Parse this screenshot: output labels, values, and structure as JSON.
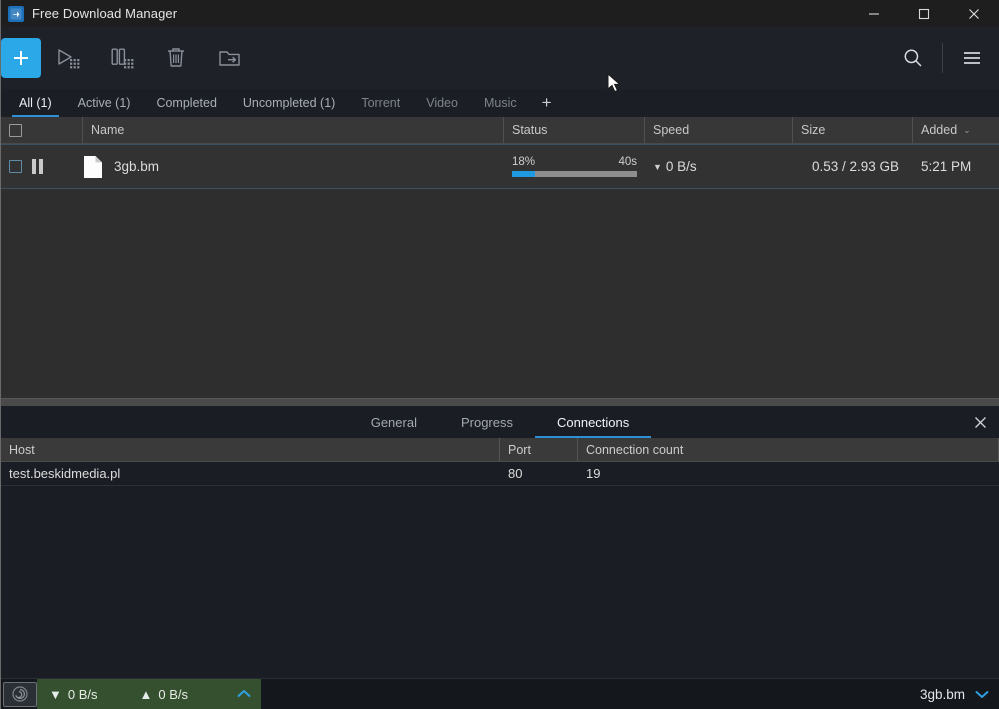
{
  "window": {
    "title": "Free Download Manager",
    "app_icon": "download-arrow-icon",
    "minimize_label": "–",
    "maximize_label": "□",
    "close_label": "✕"
  },
  "toolbar": {
    "add_label": "+",
    "buttons": [
      {
        "name": "resume-all-button",
        "icon": "play-all-icon"
      },
      {
        "name": "pause-all-button",
        "icon": "pause-all-icon"
      },
      {
        "name": "delete-button",
        "icon": "trash-icon"
      },
      {
        "name": "move-to-folder-button",
        "icon": "folder-move-icon"
      }
    ],
    "search_icon": "search-icon",
    "menu_icon": "hamburger-menu-icon"
  },
  "filters": {
    "tabs": [
      {
        "label": "All (1)",
        "active": true
      },
      {
        "label": "Active (1)",
        "active": false
      },
      {
        "label": "Completed",
        "active": false
      },
      {
        "label": "Uncompleted (1)",
        "active": false
      },
      {
        "label": "Torrent",
        "active": false
      },
      {
        "label": "Video",
        "active": false
      },
      {
        "label": "Music",
        "active": false
      }
    ],
    "add_tab_label": "+"
  },
  "downloads": {
    "columns": {
      "name": "Name",
      "status": "Status",
      "speed": "Speed",
      "size": "Size",
      "added": "Added",
      "sort_caret": "⌄"
    },
    "rows": [
      {
        "filename": "3gb.bm",
        "state_icon": "pause-icon",
        "file_icon": "file-icon",
        "progress_percent": "18%",
        "progress_value": 18,
        "eta": "40s",
        "speed": "0 B/s",
        "speed_arrow": "▼",
        "size": "0.53 / 2.93 GB",
        "added": "5:21 PM",
        "selected": true
      }
    ]
  },
  "detail_panel": {
    "tabs": [
      {
        "label": "General",
        "active": false
      },
      {
        "label": "Progress",
        "active": false
      },
      {
        "label": "Connections",
        "active": true
      }
    ],
    "close_label": "✕",
    "connections": {
      "columns": {
        "host": "Host",
        "port": "Port",
        "count": "Connection count"
      },
      "rows": [
        {
          "host": "test.beskidmedia.pl",
          "port": "80",
          "count": "19"
        }
      ]
    }
  },
  "statusbar": {
    "tray_icon": "spiral-status-icon",
    "download_arrow": "▼",
    "download_speed": "0 B/s",
    "upload_arrow": "▲",
    "upload_speed": "0 B/s",
    "expand_caret": "⌃",
    "current_file": "3gb.bm",
    "file_caret": "⌄"
  },
  "colors": {
    "accent": "#2ba8e8",
    "tab_underline": "#2f8fd4",
    "progress_fill": "#1e9ae0",
    "progress_track": "#8e8e8e",
    "speed_panel": "#35502f"
  }
}
